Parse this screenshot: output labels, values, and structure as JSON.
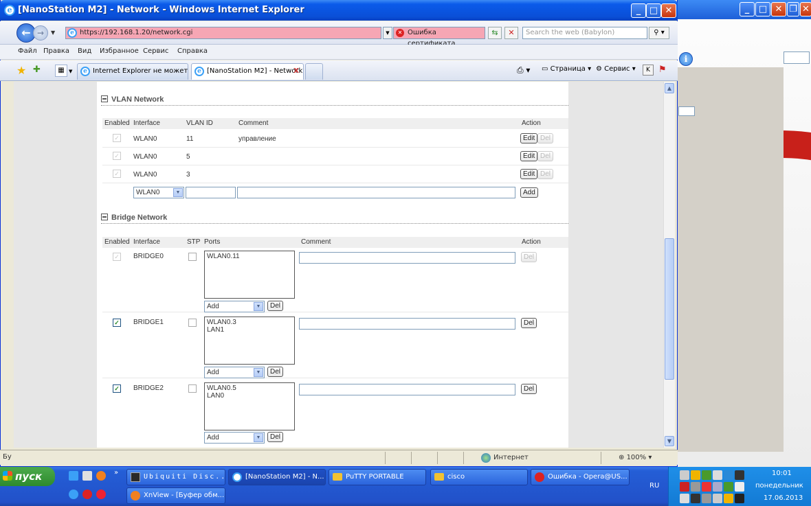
{
  "window": {
    "title": "[NanoStation M2] - Network - Windows Internet Explorer",
    "url": "https://192.168.1.20/network.cgi",
    "cert_error": "Ошибка сертификата",
    "search_placeholder": "Search the web (Babylon)"
  },
  "menu": [
    "Файл",
    "Правка",
    "Вид",
    "Избранное",
    "Сервис",
    "Справка"
  ],
  "tabs": [
    {
      "label": "Internet Explorer не может ..."
    },
    {
      "label": "[NanoStation M2] - Network",
      "close": "X"
    }
  ],
  "command_bar": {
    "page": "Страница",
    "tools": "Сервис"
  },
  "vlan": {
    "title": "VLAN Network",
    "headers": {
      "enabled": "Enabled",
      "interface": "Interface",
      "vlan_id": "VLAN ID",
      "comment": "Comment",
      "action": "Action"
    },
    "rows": [
      {
        "interface": "WLAN0",
        "vlan_id": "11",
        "comment": "управление",
        "edit": "Edit",
        "del": "Del"
      },
      {
        "interface": "WLAN0",
        "vlan_id": "5",
        "comment": "",
        "edit": "Edit",
        "del": "Del"
      },
      {
        "interface": "WLAN0",
        "vlan_id": "3",
        "comment": "",
        "edit": "Edit",
        "del": "Del"
      }
    ],
    "new_row": {
      "interface": "WLAN0",
      "add": "Add"
    }
  },
  "bridge": {
    "title": "Bridge Network",
    "headers": {
      "enabled": "Enabled",
      "interface": "Interface",
      "stp": "STP",
      "ports": "Ports",
      "comment": "Comment",
      "action": "Action"
    },
    "rows": [
      {
        "interface": "BRIDGE0",
        "ports": "WLAN0.11",
        "add": "Add",
        "del": "Del",
        "row_del": "Del"
      },
      {
        "interface": "BRIDGE1",
        "ports": "WLAN0.3\nLAN1",
        "add": "Add",
        "del": "Del",
        "row_del": "Del"
      },
      {
        "interface": "BRIDGE2",
        "ports": "WLAN0.5\nLAN0",
        "add": "Add",
        "del": "Del",
        "row_del": "Del"
      }
    ]
  },
  "status": {
    "zone": "Интернет",
    "zoom": "100%",
    "left_text": "Бу"
  },
  "taskbar": {
    "start": "пуск",
    "items": [
      "Ubiquiti Disc...",
      "[NanoStation M2] - N...",
      "PuTTY PORTABLE",
      "cisco",
      "Ошибка - Opera@US...",
      "XnView - [Буфер обм..."
    ],
    "lang": "RU",
    "time": "10:01",
    "weekday": "понедельник",
    "date": "17.06.2013"
  },
  "colors": {
    "xp_blue": "#0b5bea",
    "cert_error_bg": "#f6a6b4",
    "checkbox_green": "#2a8a2a"
  }
}
